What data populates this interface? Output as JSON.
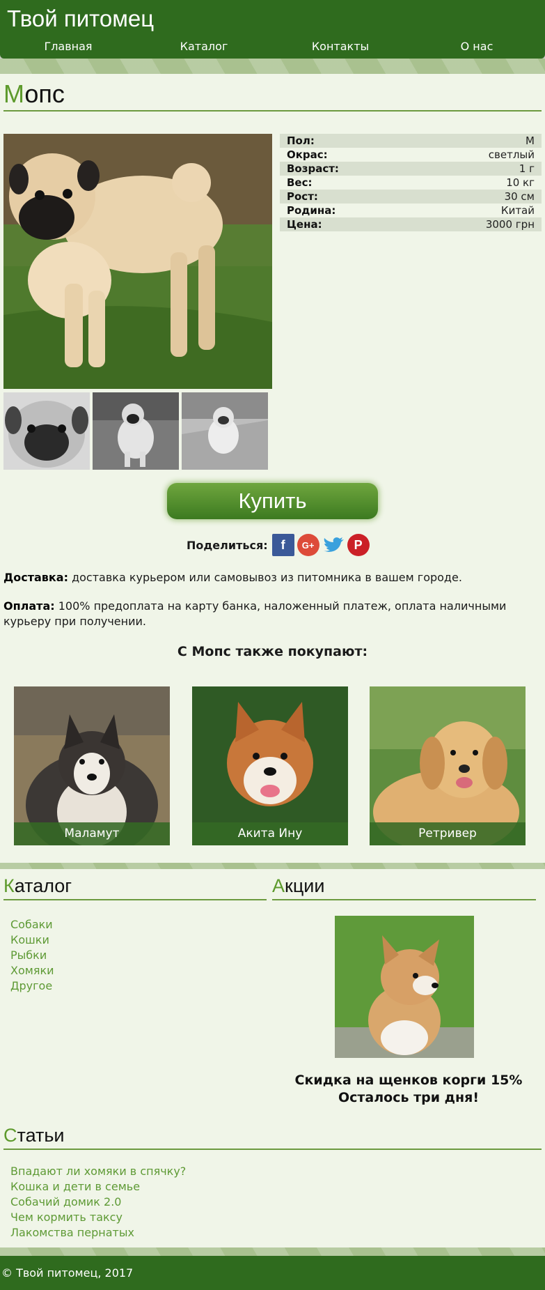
{
  "header": {
    "site_title": "Твой питомец",
    "nav": [
      "Главная",
      "Каталог",
      "Контакты",
      "О нас"
    ]
  },
  "product": {
    "title_first": "М",
    "title_rest": "опс",
    "specs": [
      {
        "key": "Пол:",
        "value": "М"
      },
      {
        "key": "Окрас:",
        "value": "светлый"
      },
      {
        "key": "Возраст:",
        "value": "1 г"
      },
      {
        "key": "Вес:",
        "value": "10 кг"
      },
      {
        "key": "Рост:",
        "value": "30 см"
      },
      {
        "key": "Родина:",
        "value": "Китай"
      },
      {
        "key": "Цена:",
        "value": "3000 грн"
      }
    ],
    "buy_label": "Купить",
    "share_label": "Поделиться:",
    "share_icons": [
      "facebook-icon",
      "google-plus-icon",
      "twitter-icon",
      "pinterest-icon"
    ],
    "delivery_label": "Доставка:",
    "delivery_text": "доставка курьером или самовывоз из питомника в вашем городе.",
    "payment_label": "Оплата:",
    "payment_text": "100% предоплата на карту банка, наложенный платеж, оплата наличными курьеру при получении."
  },
  "also_bought": {
    "title": "С Мопс также покупают:",
    "items": [
      "Маламут",
      "Акита Ину",
      "Ретривер"
    ]
  },
  "catalog": {
    "title_first": "К",
    "title_rest": "аталог",
    "items": [
      "Собаки",
      "Кошки",
      "Рыбки",
      "Хомяки",
      "Другое"
    ]
  },
  "promo": {
    "title_first": "А",
    "title_rest": "кции",
    "line1": "Скидка на щенков корги 15%",
    "line2": "Осталось три дня!"
  },
  "articles": {
    "title_first": "С",
    "title_rest": "татьи",
    "items": [
      "Впадают ли хомяки в спячку?",
      "Кошка и дети в семье",
      "Собачий домик 2.0",
      "Чем кормить таксу",
      "Лакомства пернатых"
    ]
  },
  "footer": {
    "text": "© Твой питомец, 2017"
  },
  "colors": {
    "header": "#2f6b1e",
    "accent": "#5d9a2c",
    "band": "#a9c18f",
    "background": "#f0f5e8"
  }
}
